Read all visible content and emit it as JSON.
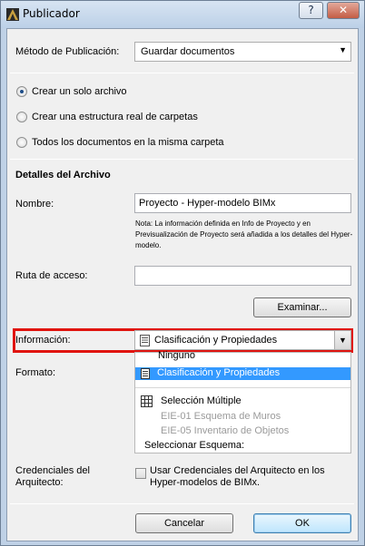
{
  "window": {
    "title": "Publicador",
    "help_label": "?",
    "close_label": "✕"
  },
  "publish_method": {
    "label": "Método de Publicación:",
    "value": "Guardar documentos"
  },
  "options": [
    {
      "label": "Crear un solo archivo",
      "selected": true
    },
    {
      "label": "Crear una estructura real de carpetas",
      "selected": false
    },
    {
      "label": "Todos los documentos en la misma carpeta",
      "selected": false
    }
  ],
  "file_details": {
    "heading": "Detalles del Archivo",
    "name_label": "Nombre:",
    "name_value": "Proyecto - Hyper-modelo BIMx",
    "note": "Nota: La información definida en Info de Proyecto y en Previsualización de Proyecto será añadida a los detalles del Hyper-modelo.",
    "path_label": "Ruta de acceso:",
    "path_value": "",
    "browse_label": "Examinar..."
  },
  "information": {
    "label": "Información:",
    "value": "Clasificación y Propiedades",
    "icon": "document-icon"
  },
  "format_label": "Formato:",
  "dropdown": {
    "items": [
      {
        "label": "Ninguno",
        "state": "normal"
      },
      {
        "label": "Clasificación y Propiedades",
        "state": "selected",
        "icon": "document-icon"
      },
      {
        "label": "Selección Múltiple",
        "state": "normal",
        "icon": "grid-icon"
      },
      {
        "label": "EIE-01 Esquema de Muros",
        "state": "disabled"
      },
      {
        "label": "EIE-05 Inventario de Objetos",
        "state": "disabled"
      },
      {
        "label": "Seleccionar Esquema:",
        "state": "normal"
      }
    ],
    "selection_color": "#3399ff"
  },
  "credentials": {
    "label_line1": "Credenciales del",
    "label_line2": "Arquitecto:",
    "checkbox_line1": "Usar Credenciales del Arquitecto en los",
    "checkbox_line2": "Hyper-modelos de BIMx.",
    "checked": false
  },
  "footer": {
    "cancel_label": "Cancelar",
    "ok_label": "OK"
  },
  "colors": {
    "highlight_border": "#e0140f",
    "window_frame": "#bfd1e6"
  }
}
